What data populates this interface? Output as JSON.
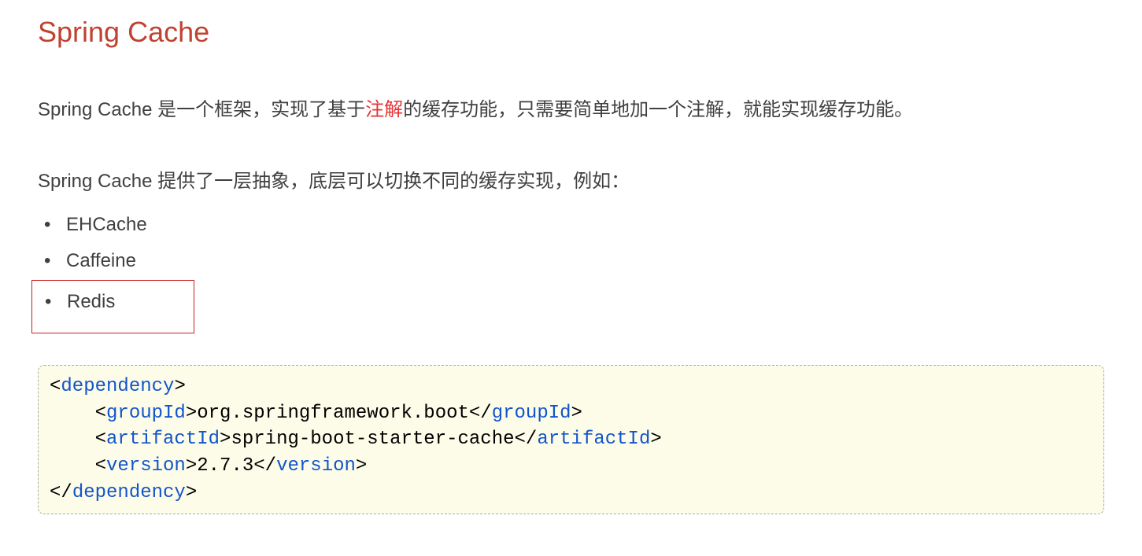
{
  "title": "Spring Cache",
  "para1_before": "Spring Cache 是一个框架，实现了基于",
  "para1_highlight": "注解",
  "para1_after": "的缓存功能，只需要简单地加一个注解，就能实现缓存功能。",
  "para2": "Spring Cache 提供了一层抽象，底层可以切换不同的缓存实现，例如：",
  "list": {
    "item1": "EHCache",
    "item2": "Caffeine",
    "item3": "Redis"
  },
  "code": {
    "tag_dependency": "dependency",
    "tag_groupId": "groupId",
    "tag_artifactId": "artifactId",
    "tag_version": "version",
    "val_groupId": "org.springframework.boot",
    "val_artifactId": "spring-boot-starter-cache",
    "val_version": "2.7.3",
    "lt": "<",
    "gt": ">",
    "lts": "</",
    "indent": "    "
  }
}
